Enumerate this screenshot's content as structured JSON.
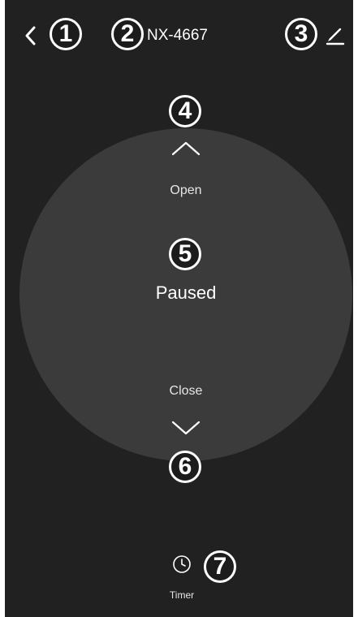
{
  "header": {
    "device_name": "NX-4667",
    "back_icon": "chevron-left-icon",
    "edit_icon": "pencil-icon"
  },
  "control": {
    "open_label": "Open",
    "status": "Paused",
    "close_label": "Close",
    "open_icon": "chevron-up-icon",
    "close_icon": "chevron-down-icon"
  },
  "footer": {
    "timer_label": "Timer",
    "timer_icon": "clock-icon"
  },
  "annotations": [
    "1",
    "2",
    "3",
    "4",
    "5",
    "6",
    "7"
  ],
  "colors": {
    "background": "#212121",
    "dial": "#3b3b3b",
    "text": "#ffffff"
  }
}
